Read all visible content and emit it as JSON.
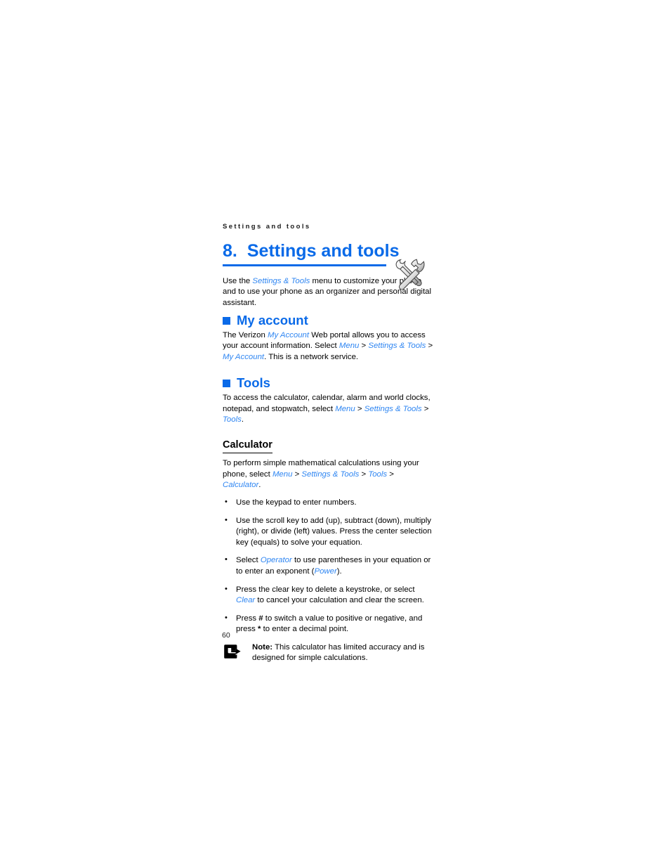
{
  "page": {
    "running_header": "Settings and tools",
    "folio": "60",
    "accent_color": "#0a6ae8",
    "link_color": "#2f86f2"
  },
  "chapter": {
    "number": "8.",
    "title": "Settings and tools",
    "icon": "tools-hammer-wrench-icon"
  },
  "intro": {
    "part1": "Use the ",
    "menu1": "Settings & Tools",
    "part2": " menu to customize your phone and to use your phone as an organizer and personal digital assistant."
  },
  "sections": [
    {
      "id": "my-account",
      "heading": "My account",
      "paragraph": {
        "part1": "The Verizon ",
        "menu1": "My Account",
        "part2": " Web portal allows you to access your account information. Select ",
        "menu2": "Menu",
        "sep1": " > ",
        "menu3": "Settings & Tools",
        "sep2": " > ",
        "menu4": "My Account",
        "part3": ". This is a network service."
      }
    },
    {
      "id": "tools",
      "heading": "Tools",
      "paragraph": {
        "part1": "To access the calculator, calendar, alarm and world clocks, notepad, and stopwatch, select ",
        "menu1": "Menu",
        "sep1": " > ",
        "menu2": "Settings & Tools",
        "sep2": " > ",
        "menu3": "Tools",
        "part2": "."
      }
    }
  ],
  "calculator": {
    "heading": "Calculator",
    "intro": {
      "part1": "To perform simple mathematical calculations using your phone, select ",
      "menu1": "Menu",
      "sep1": " > ",
      "menu2": "Settings & Tools",
      "sep2": " > ",
      "menu3": "Tools",
      "sep3": " > ",
      "menu4": "Calculator",
      "part2": "."
    },
    "bullets": [
      {
        "part1": "Use the keypad to enter numbers."
      },
      {
        "part1": "Use the scroll key to add (up), subtract (down), multiply (right), or divide (left) values. Press the center selection key (equals) to solve your equation."
      },
      {
        "part1": "Select ",
        "menu1": "Operator",
        "part2": " to use parentheses in your equation or to enter an exponent (",
        "menu2": "Power",
        "part3": ")."
      },
      {
        "part1": "Press the clear key to delete a keystroke, or select ",
        "menu1": "Clear",
        "part2": " to cancel your calculation and clear the screen."
      },
      {
        "part1": "Press ",
        "bold1": "#",
        "part2": " to switch a value to positive or negative, and press ",
        "bold2": "*",
        "part3": " to enter a decimal point."
      }
    ],
    "note": {
      "icon": "note-arrow-icon",
      "label": "Note:",
      "text": " This calculator has limited accuracy and is designed for simple calculations."
    }
  }
}
